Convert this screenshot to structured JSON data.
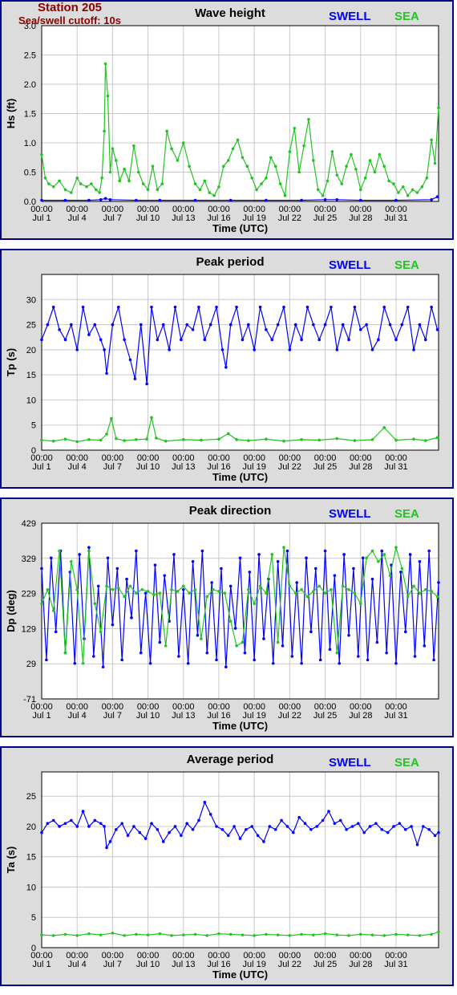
{
  "header": {
    "station": "Station 205",
    "cutoff": "Sea/swell cutoff: 10s"
  },
  "legend": {
    "swell": "SWELL",
    "sea": "SEA"
  },
  "colors": {
    "swell": "#0000ff",
    "sea": "#22c522",
    "panel_bg": "#dcdcdc",
    "plot_bg": "#ffffff",
    "grid": "#c8c8c8",
    "frame": "#00008b",
    "station_text": "#8b0000"
  },
  "chart_data": [
    {
      "type": "line",
      "title": "Wave height",
      "xlabel": "Time (UTC)",
      "ylabel": "Hs (ft)",
      "ylim": [
        0,
        3
      ],
      "yticks": [
        "0.0",
        "0.5",
        "1.0",
        "1.5",
        "2.0",
        "2.5",
        "3.0"
      ],
      "xlim": [
        0,
        33.6
      ],
      "xticks": [
        "00:00 Jul 1",
        "00:00 Jul 4",
        "00:00 Jul 7",
        "00:00 Jul 10",
        "00:00 Jul 13",
        "00:00 Jul 16",
        "00:00 Jul 19",
        "00:00 Jul 22",
        "00:00 Jul 25",
        "00:00 Jul 28",
        "00:00 Jul 31"
      ],
      "grid": true,
      "series": [
        {
          "name": "SWELL",
          "color": "#0000ff",
          "x": [
            0,
            2,
            4,
            5,
            5.4,
            5.8,
            8,
            10,
            13,
            16,
            19,
            22,
            24,
            25,
            27,
            30,
            33,
            33.5
          ],
          "y": [
            0.02,
            0.02,
            0.02,
            0.03,
            0.05,
            0.03,
            0.02,
            0.02,
            0.02,
            0.02,
            0.02,
            0.02,
            0.03,
            0.03,
            0.02,
            0.02,
            0.03,
            0.08
          ]
        },
        {
          "name": "SEA",
          "color": "#22c522",
          "x": [
            0,
            0.3,
            0.6,
            1,
            1.5,
            2,
            2.5,
            3,
            3.3,
            3.8,
            4.2,
            4.6,
            4.9,
            5.1,
            5.3,
            5.4,
            5.6,
            5.8,
            6,
            6.3,
            6.6,
            7,
            7.4,
            7.8,
            8.2,
            8.6,
            9,
            9.4,
            9.8,
            10.2,
            10.6,
            11,
            11.5,
            12,
            12.5,
            13,
            13.4,
            13.8,
            14.2,
            14.6,
            15,
            15.4,
            15.8,
            16.2,
            16.6,
            17,
            17.4,
            17.8,
            18.2,
            18.6,
            19,
            19.4,
            19.8,
            20.2,
            20.6,
            21,
            21.4,
            21.8,
            22.2,
            22.6,
            23,
            23.4,
            23.8,
            24.2,
            24.6,
            25,
            25.4,
            25.8,
            26.2,
            26.6,
            27,
            27.4,
            27.8,
            28.2,
            28.6,
            29,
            29.4,
            29.8,
            30.2,
            30.6,
            31,
            31.4,
            31.8,
            32.2,
            32.6,
            33,
            33.3,
            33.6
          ],
          "y": [
            0.8,
            0.4,
            0.3,
            0.25,
            0.35,
            0.2,
            0.15,
            0.4,
            0.3,
            0.25,
            0.3,
            0.2,
            0.15,
            0.4,
            1.2,
            2.35,
            1.8,
            0.5,
            0.9,
            0.7,
            0.35,
            0.55,
            0.35,
            0.95,
            0.5,
            0.3,
            0.2,
            0.6,
            0.2,
            0.3,
            1.2,
            0.9,
            0.7,
            1.0,
            0.6,
            0.3,
            0.2,
            0.35,
            0.15,
            0.1,
            0.25,
            0.6,
            0.7,
            0.9,
            1.05,
            0.75,
            0.6,
            0.4,
            0.2,
            0.3,
            0.4,
            0.75,
            0.6,
            0.3,
            0.1,
            0.85,
            1.25,
            0.5,
            0.95,
            1.4,
            0.7,
            0.2,
            0.1,
            0.35,
            0.85,
            0.45,
            0.3,
            0.6,
            0.8,
            0.55,
            0.2,
            0.4,
            0.7,
            0.5,
            0.8,
            0.6,
            0.35,
            0.3,
            0.15,
            0.25,
            0.1,
            0.2,
            0.15,
            0.25,
            0.4,
            1.05,
            0.65,
            1.6
          ]
        }
      ]
    },
    {
      "type": "line",
      "title": "Peak period",
      "xlabel": "Time (UTC)",
      "ylabel": "Tp (s)",
      "ylim": [
        0,
        35
      ],
      "yticks": [
        "0",
        "5",
        "10",
        "15",
        "20",
        "25",
        "30"
      ],
      "xlim": [
        0,
        33.6
      ],
      "xticks": [
        "00:00 Jul 1",
        "00:00 Jul 4",
        "00:00 Jul 7",
        "00:00 Jul 10",
        "00:00 Jul 13",
        "00:00 Jul 16",
        "00:00 Jul 19",
        "00:00 Jul 22",
        "00:00 Jul 25",
        "00:00 Jul 28",
        "00:00 Jul 31"
      ],
      "grid": true,
      "series": [
        {
          "name": "SWELL",
          "color": "#0000ff",
          "x": [
            0,
            0.5,
            1,
            1.5,
            2,
            2.5,
            3,
            3.5,
            4,
            4.5,
            5,
            5.3,
            5.5,
            6,
            6.5,
            7,
            7.5,
            7.9,
            8.4,
            8.9,
            9.3,
            9.8,
            10.3,
            10.8,
            11.3,
            11.8,
            12.3,
            12.8,
            13.3,
            13.8,
            14.3,
            14.8,
            15.3,
            15.6,
            16,
            16.5,
            17,
            17.5,
            18,
            18.5,
            19,
            19.5,
            20,
            20.5,
            21,
            21.5,
            22,
            22.5,
            23,
            23.5,
            24,
            24.5,
            25,
            25.5,
            26,
            26.5,
            27,
            27.5,
            28,
            28.5,
            29,
            29.5,
            30,
            30.5,
            31,
            31.5,
            32,
            32.5,
            33,
            33.5
          ],
          "y": [
            22,
            25,
            28.5,
            24,
            22,
            25,
            20,
            28.5,
            23,
            25,
            22,
            20,
            15.3,
            25,
            28.5,
            22,
            18,
            14.2,
            25,
            13.2,
            28.5,
            22,
            25,
            20,
            28.5,
            22,
            25,
            24,
            28.5,
            22,
            25,
            28.5,
            20,
            16.5,
            25,
            28.5,
            22,
            25,
            20,
            28.5,
            24,
            22,
            25,
            28.5,
            20,
            25,
            22,
            28.5,
            25,
            22,
            25,
            28.5,
            20,
            25,
            22,
            28.5,
            24,
            25,
            20,
            22,
            28.5,
            25,
            22,
            25,
            28.5,
            20,
            25,
            22,
            28.5,
            24
          ]
        },
        {
          "name": "SEA",
          "color": "#22c522",
          "x": [
            0,
            1,
            2,
            3,
            4,
            5,
            5.5,
            5.9,
            6.3,
            7,
            8,
            8.9,
            9.3,
            9.7,
            10.5,
            12,
            13.5,
            15,
            15.8,
            16.5,
            17.5,
            19,
            20.5,
            22,
            23.5,
            25,
            26.5,
            28,
            29,
            30,
            31.5,
            32.5,
            33.5
          ],
          "y": [
            2,
            1.8,
            2.2,
            1.7,
            2.1,
            2,
            3.2,
            6.3,
            2.3,
            1.9,
            2.1,
            2.2,
            6.5,
            2.4,
            1.8,
            2.1,
            2,
            2.2,
            3.3,
            2.1,
            1.9,
            2.2,
            1.8,
            2.1,
            2,
            2.3,
            1.9,
            2.1,
            4.5,
            2,
            2.2,
            1.9,
            2.5
          ]
        }
      ]
    },
    {
      "type": "line",
      "title": "Peak direction",
      "xlabel": "Time (UTC)",
      "ylabel": "Dp (deg)",
      "ylim": [
        -71,
        429
      ],
      "yticks": [
        "-71",
        "29",
        "129",
        "229",
        "329",
        "429"
      ],
      "xlim": [
        0,
        33.6
      ],
      "xticks": [
        "00:00 Jul 1",
        "00:00 Jul 4",
        "00:00 Jul 7",
        "00:00 Jul 10",
        "00:00 Jul 13",
        "00:00 Jul 16",
        "00:00 Jul 19",
        "00:00 Jul 22",
        "00:00 Jul 25",
        "00:00 Jul 28",
        "00:00 Jul 31"
      ],
      "grid": true,
      "series": [
        {
          "name": "SWELL",
          "color": "#0000ff",
          "x": [
            0,
            0.4,
            0.8,
            1.2,
            1.6,
            2,
            2.4,
            2.8,
            3.2,
            3.6,
            4,
            4.4,
            4.8,
            5.2,
            5.6,
            6,
            6.4,
            6.8,
            7.2,
            7.6,
            8,
            8.4,
            8.8,
            9.2,
            9.6,
            10,
            10.4,
            10.8,
            11.2,
            11.6,
            12,
            12.4,
            12.8,
            13.2,
            13.6,
            14,
            14.4,
            14.8,
            15.2,
            15.6,
            16,
            16.4,
            16.8,
            17.2,
            17.6,
            18,
            18.4,
            18.8,
            19.2,
            19.6,
            20,
            20.4,
            20.8,
            21.2,
            21.6,
            22,
            22.4,
            22.8,
            23.2,
            23.6,
            24,
            24.4,
            24.8,
            25.2,
            25.6,
            26,
            26.4,
            26.8,
            27.2,
            27.6,
            28,
            28.4,
            28.8,
            29.2,
            29.6,
            30,
            30.4,
            30.8,
            31.2,
            31.6,
            32,
            32.4,
            32.8,
            33.2,
            33.6
          ],
          "y": [
            300,
            40,
            330,
            120,
            350,
            60,
            290,
            30,
            340,
            100,
            360,
            50,
            250,
            20,
            330,
            140,
            300,
            40,
            270,
            160,
            350,
            60,
            230,
            30,
            310,
            90,
            280,
            150,
            340,
            50,
            240,
            30,
            320,
            110,
            350,
            60,
            260,
            40,
            300,
            20,
            250,
            130,
            330,
            60,
            290,
            40,
            340,
            100,
            270,
            30,
            320,
            80,
            350,
            50,
            260,
            30,
            330,
            120,
            300,
            40,
            350,
            70,
            280,
            30,
            340,
            110,
            300,
            50,
            330,
            40,
            270,
            90,
            350,
            60,
            310,
            30,
            290,
            120,
            340,
            50,
            320,
            80,
            350,
            40,
            260
          ]
        },
        {
          "name": "SEA",
          "color": "#22c522",
          "x": [
            0,
            0.5,
            1,
            1.5,
            2,
            2.5,
            3,
            3.5,
            4,
            4.5,
            5,
            5.5,
            6,
            6.5,
            7,
            7.5,
            8,
            8.5,
            9,
            9.5,
            10,
            10.5,
            11,
            11.5,
            12,
            12.5,
            13,
            13.5,
            14,
            14.5,
            15,
            15.5,
            16,
            16.5,
            17,
            17.5,
            18,
            18.5,
            19,
            19.5,
            20,
            20.5,
            21,
            21.5,
            22,
            22.5,
            23,
            23.5,
            24,
            24.5,
            25,
            25.5,
            26,
            26.5,
            27,
            27.5,
            28,
            28.5,
            29,
            29.5,
            30,
            30.5,
            31,
            31.5,
            32,
            32.5,
            33,
            33.5
          ],
          "y": [
            200,
            240,
            180,
            350,
            60,
            320,
            240,
            30,
            350,
            200,
            120,
            250,
            240,
            245,
            220,
            250,
            230,
            240,
            235,
            225,
            230,
            80,
            240,
            235,
            250,
            230,
            240,
            100,
            220,
            240,
            235,
            230,
            150,
            80,
            90,
            240,
            200,
            250,
            230,
            340,
            90,
            360,
            250,
            230,
            240,
            220,
            235,
            250,
            230,
            240,
            60,
            250,
            240,
            230,
            200,
            330,
            350,
            320,
            340,
            280,
            360,
            300,
            220,
            250,
            230,
            240,
            235,
            220
          ]
        }
      ]
    },
    {
      "type": "line",
      "title": "Average period",
      "xlabel": "Time (UTC)",
      "ylabel": "Ta (s)",
      "ylim": [
        0,
        29
      ],
      "yticks": [
        "0",
        "5",
        "10",
        "15",
        "20",
        "25"
      ],
      "xlim": [
        0,
        33.6
      ],
      "xticks": [
        "00:00 Jul 1",
        "00:00 Jul 4",
        "00:00 Jul 7",
        "00:00 Jul 10",
        "00:00 Jul 13",
        "00:00 Jul 16",
        "00:00 Jul 19",
        "00:00 Jul 22",
        "00:00 Jul 25",
        "00:00 Jul 28",
        "00:00 Jul 31"
      ],
      "grid": true,
      "series": [
        {
          "name": "SWELL",
          "color": "#0000ff",
          "x": [
            0,
            0.5,
            1,
            1.5,
            2,
            2.5,
            3,
            3.5,
            4,
            4.5,
            5,
            5.3,
            5.5,
            5.8,
            6.3,
            6.8,
            7.3,
            7.8,
            8.3,
            8.8,
            9.3,
            9.8,
            10.3,
            10.8,
            11.3,
            11.8,
            12.3,
            12.8,
            13.3,
            13.8,
            14.3,
            14.8,
            15.3,
            15.8,
            16.3,
            16.8,
            17.3,
            17.8,
            18.3,
            18.8,
            19.3,
            19.8,
            20.3,
            20.8,
            21.3,
            21.8,
            22.3,
            22.8,
            23.3,
            23.8,
            24.3,
            24.8,
            25.3,
            25.8,
            26.3,
            26.8,
            27.3,
            27.8,
            28.3,
            28.8,
            29.3,
            29.8,
            30.3,
            30.8,
            31.3,
            31.8,
            32.3,
            32.8,
            33.3,
            33.6
          ],
          "y": [
            19,
            20.5,
            21,
            20,
            20.5,
            21,
            20,
            22.5,
            20,
            21,
            20.5,
            20,
            16.5,
            17.5,
            19.5,
            20.5,
            18.5,
            20,
            19,
            18,
            20.5,
            19.5,
            17.5,
            19,
            20,
            18.5,
            20.5,
            19.5,
            21,
            24,
            22,
            20,
            19.5,
            18.5,
            20,
            18,
            19.5,
            20,
            18.5,
            17.5,
            20,
            19.5,
            21,
            20,
            19,
            21.5,
            20.5,
            19.5,
            20,
            21,
            22.5,
            20.5,
            21,
            19.5,
            20,
            20.5,
            19,
            20,
            20.5,
            19.5,
            19,
            20,
            20.5,
            19.5,
            20,
            17,
            20,
            19.5,
            18.5,
            19
          ]
        },
        {
          "name": "SEA",
          "color": "#22c522",
          "x": [
            0,
            1,
            2,
            3,
            4,
            5,
            6,
            7,
            8,
            9,
            10,
            11,
            12,
            13,
            14,
            15,
            16,
            17,
            18,
            19,
            20,
            21,
            22,
            23,
            24,
            25,
            26,
            27,
            28,
            29,
            30,
            31,
            32,
            33,
            33.6
          ],
          "y": [
            2.1,
            2,
            2.2,
            2,
            2.3,
            2.1,
            2.4,
            2,
            2.2,
            2.1,
            2.3,
            2,
            2.1,
            2.2,
            2,
            2.3,
            2.2,
            2.1,
            2,
            2.2,
            2.1,
            2,
            2.2,
            2.1,
            2.3,
            2.1,
            2,
            2.2,
            2.1,
            2,
            2.2,
            2.1,
            2,
            2.2,
            2.6
          ]
        }
      ]
    }
  ]
}
